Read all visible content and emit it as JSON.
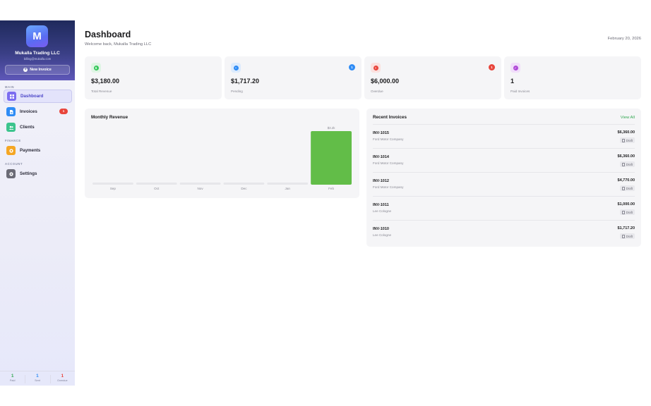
{
  "sidebar": {
    "avatar_letter": "M",
    "company_name": "Mukalla Trading LLC",
    "company_email": "billing@mukalla.com",
    "new_invoice_label": "New Invoice",
    "sections": {
      "main": "MAIN",
      "finance": "FINANCE",
      "account": "ACCOUNT"
    },
    "items": [
      {
        "label": "Dashboard",
        "icon": "grid-icon",
        "color": "#7b6cf0"
      },
      {
        "label": "Invoices",
        "icon": "document-icon",
        "color": "#2f8cf5",
        "badge": "1"
      },
      {
        "label": "Clients",
        "icon": "users-icon",
        "color": "#3cc48d"
      },
      {
        "label": "Payments",
        "icon": "coin-icon",
        "color": "#f5a623"
      },
      {
        "label": "Settings",
        "icon": "gear-icon",
        "color": "#6b6b76"
      }
    ],
    "stats": [
      {
        "value": "1",
        "label": "Paid",
        "color": "#34a853"
      },
      {
        "value": "1",
        "label": "Sent",
        "color": "#2f8cf5"
      },
      {
        "value": "1",
        "label": "Overdue",
        "color": "#e8453c"
      }
    ]
  },
  "header": {
    "title": "Dashboard",
    "welcome": "Welcome back, Mukalla Trading LLC",
    "date": "February 20, 2026"
  },
  "stats": [
    {
      "value": "$3,180.00",
      "label": "Total Revenue",
      "icon": "dollar-icon",
      "color": "#34c759",
      "bg": "#dff5e4",
      "glyph": "$"
    },
    {
      "value": "$1,717.20",
      "label": "Pending",
      "icon": "clock-icon",
      "color": "#2f8cf5",
      "bg": "#dcebfd",
      "glyph": "•",
      "badge": "1"
    },
    {
      "value": "$6,000.00",
      "label": "Overdue",
      "icon": "alert-icon",
      "color": "#e8453c",
      "bg": "#fbe1df",
      "glyph": "!",
      "badge": "1"
    },
    {
      "value": "1",
      "label": "Paid Invoices",
      "icon": "check-icon",
      "color": "#b04ad8",
      "bg": "#f1defa",
      "glyph": "✓"
    }
  ],
  "chart": {
    "title": "Monthly Revenue"
  },
  "chart_data": {
    "type": "bar",
    "categories": [
      "Sep",
      "Oct",
      "Nov",
      "Dec",
      "Jan",
      "Feb"
    ],
    "values": [
      0,
      0,
      0,
      0,
      0,
      3180
    ],
    "value_labels": [
      "",
      "",
      "",
      "",
      "",
      "$3.2k"
    ],
    "bar_color": "#62bd48",
    "empty_color": "#e6e6ea",
    "ylim": [
      0,
      3180
    ]
  },
  "recent_invoices": {
    "title": "Recent Invoices",
    "view_all_label": "View All",
    "rows": [
      {
        "number": "INV-1015",
        "client": "Ford  Motor Company",
        "amount": "$6,360.00",
        "status": "Draft"
      },
      {
        "number": "INV-1014",
        "client": "Ford  Motor Company",
        "amount": "$6,360.00",
        "status": "Draft"
      },
      {
        "number": "INV-1012",
        "client": "Ford  Motor Company",
        "amount": "$4,770.00",
        "status": "Draft"
      },
      {
        "number": "INV-1011",
        "client": "Lee Cologne",
        "amount": "$1,000.00",
        "status": "Draft"
      },
      {
        "number": "INV-1010",
        "client": "Lee Cologne",
        "amount": "$1,717.20",
        "status": "Draft"
      }
    ]
  }
}
